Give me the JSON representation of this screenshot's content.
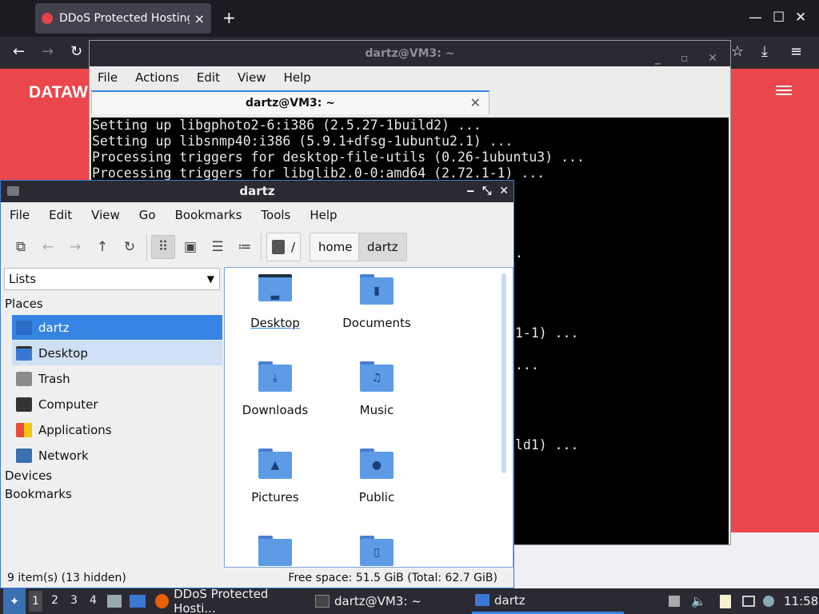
{
  "browser": {
    "tab_title": "DDoS Protected Hosting",
    "tab_close": "×",
    "new_tab": "+",
    "page_brand": "DATAW",
    "colors": {
      "page_bg": "#e9474b",
      "chrome": "#1c1b22"
    }
  },
  "terminal": {
    "window_title": "dartz@VM3: ~",
    "menu": [
      "File",
      "Actions",
      "Edit",
      "View",
      "Help"
    ],
    "tab_title": "dartz@VM3: ~",
    "lines": [
      "Setting up libgphoto2-6:i386 (2.5.27-1build2) ...",
      "Setting up libsnmp40:i386 (5.9.1+dfsg-1ubuntu2.1) ...",
      "Processing triggers for desktop-file-utils (0.26-1ubuntu3) ...",
      "Processing triggers for libglib2.0-0:amd64 (2.72.1-1) ..."
    ],
    "partial_lines": [
      ".",
      "1-1) ...",
      "...",
      "ld1) ..."
    ]
  },
  "filemanager": {
    "window_title": "dartz",
    "menu": [
      "File",
      "Edit",
      "View",
      "Go",
      "Bookmarks",
      "Tools",
      "Help"
    ],
    "path": [
      "/",
      "home",
      "dartz"
    ],
    "side_select": "Lists",
    "places_header": "Places",
    "places": [
      {
        "label": "dartz",
        "icon": "home-folder-icon"
      },
      {
        "label": "Desktop",
        "icon": "desktop-icon"
      },
      {
        "label": "Trash",
        "icon": "trash-icon"
      },
      {
        "label": "Computer",
        "icon": "computer-icon"
      },
      {
        "label": "Applications",
        "icon": "applications-icon"
      },
      {
        "label": "Network",
        "icon": "network-icon"
      }
    ],
    "devices_header": "Devices",
    "bookmarks_header": "Bookmarks",
    "items": [
      "Desktop",
      "Documents",
      "Downloads",
      "Music",
      "Pictures",
      "Public"
    ],
    "status_left": "9 item(s) (13 hidden)",
    "status_right": "Free space: 51.5 GiB (Total: 62.7 GiB)"
  },
  "taskbar": {
    "workspaces": [
      "1",
      "2",
      "3",
      "4"
    ],
    "tasks": [
      "DDoS Protected Hosti...",
      "dartz@VM3: ~",
      "dartz"
    ],
    "clock": "11:58"
  }
}
